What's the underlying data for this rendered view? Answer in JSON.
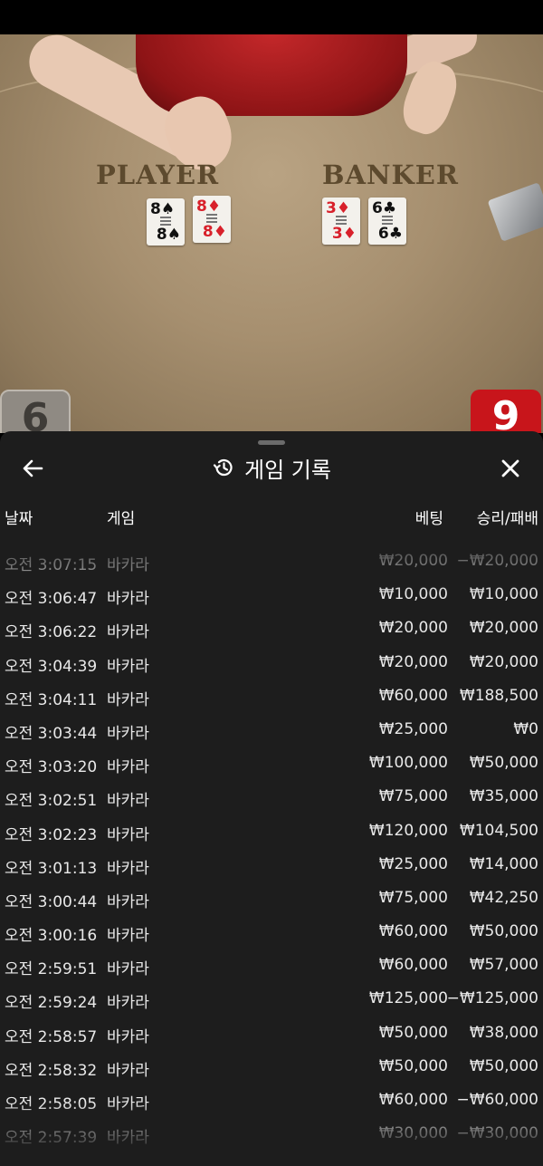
{
  "table": {
    "player_label": "PLAYER",
    "banker_label": "BANKER",
    "player_cards": [
      {
        "rank": "8",
        "suit": "♠",
        "color": "blk"
      },
      {
        "rank": "8",
        "suit": "♦",
        "color": "red"
      }
    ],
    "banker_cards": [
      {
        "rank": "3",
        "suit": "♦",
        "color": "red"
      },
      {
        "rank": "6",
        "suit": "♣",
        "color": "blk"
      }
    ],
    "player_score": "6",
    "banker_score": "9"
  },
  "sheet": {
    "title": "게임 기록",
    "columns": {
      "date": "날짜",
      "game": "게임",
      "bet": "베팅",
      "result": "승리/패배"
    },
    "rows": [
      {
        "date": "오전 3:07:15",
        "game": "바카라",
        "bet": "₩20,000",
        "result": "−₩20,000"
      },
      {
        "date": "오전 3:06:47",
        "game": "바카라",
        "bet": "₩10,000",
        "result": "₩10,000"
      },
      {
        "date": "오전 3:06:22",
        "game": "바카라",
        "bet": "₩20,000",
        "result": "₩20,000"
      },
      {
        "date": "오전 3:04:39",
        "game": "바카라",
        "bet": "₩20,000",
        "result": "₩20,000"
      },
      {
        "date": "오전 3:04:11",
        "game": "바카라",
        "bet": "₩60,000",
        "result": "₩188,500"
      },
      {
        "date": "오전 3:03:44",
        "game": "바카라",
        "bet": "₩25,000",
        "result": "₩0"
      },
      {
        "date": "오전 3:03:20",
        "game": "바카라",
        "bet": "₩100,000",
        "result": "₩50,000"
      },
      {
        "date": "오전 3:02:51",
        "game": "바카라",
        "bet": "₩75,000",
        "result": "₩35,000"
      },
      {
        "date": "오전 3:02:23",
        "game": "바카라",
        "bet": "₩120,000",
        "result": "₩104,500"
      },
      {
        "date": "오전 3:01:13",
        "game": "바카라",
        "bet": "₩25,000",
        "result": "₩14,000"
      },
      {
        "date": "오전 3:00:44",
        "game": "바카라",
        "bet": "₩75,000",
        "result": "₩42,250"
      },
      {
        "date": "오전 3:00:16",
        "game": "바카라",
        "bet": "₩60,000",
        "result": "₩50,000"
      },
      {
        "date": "오전 2:59:51",
        "game": "바카라",
        "bet": "₩60,000",
        "result": "₩57,000"
      },
      {
        "date": "오전 2:59:24",
        "game": "바카라",
        "bet": "₩125,000",
        "result": "−₩125,000"
      },
      {
        "date": "오전 2:58:57",
        "game": "바카라",
        "bet": "₩50,000",
        "result": "₩38,000"
      },
      {
        "date": "오전 2:58:32",
        "game": "바카라",
        "bet": "₩50,000",
        "result": "₩50,000"
      },
      {
        "date": "오전 2:58:05",
        "game": "바카라",
        "bet": "₩60,000",
        "result": "−₩60,000"
      },
      {
        "date": "오전 2:57:39",
        "game": "바카라",
        "bet": "₩30,000",
        "result": "−₩30,000"
      }
    ]
  },
  "icons": {
    "back": "arrow-left-icon",
    "close": "close-icon",
    "history": "history-icon"
  }
}
